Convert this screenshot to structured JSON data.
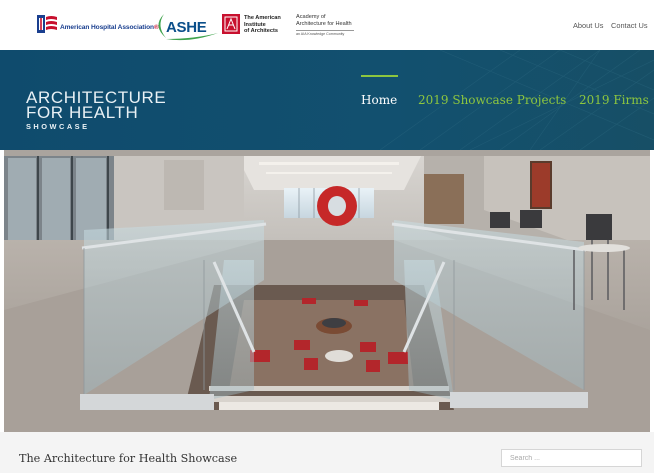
{
  "logos": {
    "aha": {
      "name_blue": "American Hospital Association",
      "name_mark": "®"
    },
    "ashe": {
      "text": "ASHE"
    },
    "aia": {
      "line1": "The American",
      "line2": "Institute",
      "line3": "of Architects"
    },
    "aah": {
      "line1": "Academy of",
      "line2": "Architecture for Health",
      "tagline": "an AIA Knowledge Community"
    }
  },
  "top_links": {
    "about": "About Us",
    "contact": "Contact Us"
  },
  "site_title": {
    "line1": "ARCHITECTURE",
    "line2": "FOR HEALTH",
    "line3": "SHOWCASE"
  },
  "nav": {
    "home": "Home",
    "projects": "2019 Showcase Projects",
    "firms": "2019 Firms"
  },
  "main": {
    "page_title": "The Architecture for Health Showcase",
    "search_placeholder": "Search ..."
  },
  "colors": {
    "header_band": "#114f73",
    "nav_active": "#ffffff",
    "nav_accent": "#8dc63f",
    "aha_blue": "#1a3f8f",
    "aia_red": "#c8102e",
    "ashe_blue": "#0b4f8a"
  }
}
